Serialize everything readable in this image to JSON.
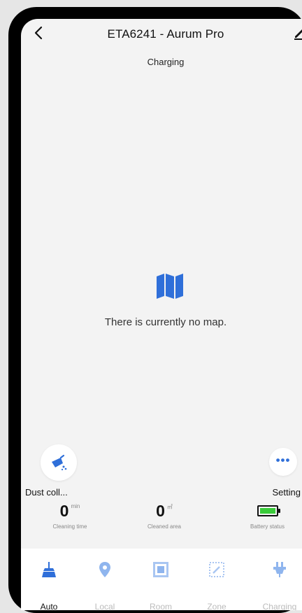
{
  "header": {
    "title": "ETA6241 - Aurum Pro"
  },
  "status": "Charging",
  "map": {
    "empty_message": "There is currently no map."
  },
  "controls": {
    "dust_label": "Dust coll...",
    "setting_label": "Setting"
  },
  "stats": [
    {
      "value": "0",
      "unit": "min",
      "label": "Cleaning time"
    },
    {
      "value": "0",
      "unit": "㎡",
      "label": "Cleaned area"
    },
    {
      "label": "Battery status"
    }
  ],
  "modes": [
    {
      "label": "Auto",
      "icon": "broom-icon",
      "active": true
    },
    {
      "label": "Local",
      "icon": "location-pin-icon",
      "active": false
    },
    {
      "label": "Room",
      "icon": "room-icon",
      "active": false
    },
    {
      "label": "Zone",
      "icon": "zone-icon",
      "active": false
    },
    {
      "label": "Charging",
      "icon": "plug-icon",
      "active": false
    }
  ],
  "colors": {
    "accent": "#2f6fd9",
    "inactive_icon": "#8fb5ee",
    "battery": "#3acb3a"
  }
}
